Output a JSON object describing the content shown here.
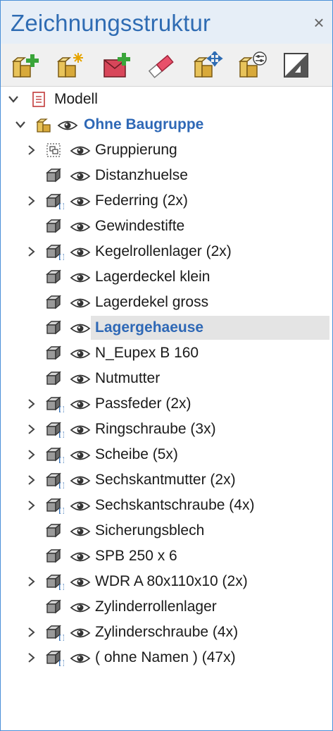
{
  "panel": {
    "title": "Zeichnungsstruktur",
    "close_symbol": "×"
  },
  "toolbar": {
    "buttons": [
      {
        "name": "new-assembly-button",
        "icon": "assembly-add-icon"
      },
      {
        "name": "new-empty-assembly-button",
        "icon": "assembly-star-icon"
      },
      {
        "name": "new-group-button",
        "icon": "group-add-icon"
      },
      {
        "name": "delete-button",
        "icon": "eraser-icon"
      },
      {
        "name": "move-button",
        "icon": "assembly-move-icon"
      },
      {
        "name": "properties-button",
        "icon": "assembly-settings-icon"
      },
      {
        "name": "visibility-toggle-button",
        "icon": "contrast-icon"
      }
    ]
  },
  "tree": {
    "root": {
      "label": "Modell",
      "icon": "document-icon",
      "expanded": true
    },
    "assembly": {
      "label": "Ohne Baugruppe",
      "icon": "assembly-icon",
      "expanded": true
    },
    "items": [
      {
        "label": "Gruppierung",
        "expandable": true,
        "kind": "group"
      },
      {
        "label": "Distanzhuelse",
        "expandable": false,
        "kind": "part"
      },
      {
        "label": "Federring (2x)",
        "expandable": true,
        "kind": "multi"
      },
      {
        "label": "Gewindestifte",
        "expandable": false,
        "kind": "part"
      },
      {
        "label": "Kegelrollenlager (2x)",
        "expandable": true,
        "kind": "multi"
      },
      {
        "label": "Lagerdeckel klein",
        "expandable": false,
        "kind": "part"
      },
      {
        "label": "Lagerdekel gross",
        "expandable": false,
        "kind": "part"
      },
      {
        "label": "Lagergehaeuse",
        "expandable": false,
        "kind": "part",
        "selected": true
      },
      {
        "label": "N_Eupex B 160",
        "expandable": false,
        "kind": "part"
      },
      {
        "label": "Nutmutter",
        "expandable": false,
        "kind": "part"
      },
      {
        "label": "Passfeder (2x)",
        "expandable": true,
        "kind": "multi"
      },
      {
        "label": "Ringschraube (3x)",
        "expandable": true,
        "kind": "multi"
      },
      {
        "label": "Scheibe (5x)",
        "expandable": true,
        "kind": "multi"
      },
      {
        "label": "Sechskantmutter (2x)",
        "expandable": true,
        "kind": "multi"
      },
      {
        "label": "Sechskantschraube (4x)",
        "expandable": true,
        "kind": "multi"
      },
      {
        "label": "Sicherungsblech",
        "expandable": false,
        "kind": "part"
      },
      {
        "label": "SPB 250 x 6",
        "expandable": false,
        "kind": "part"
      },
      {
        "label": "WDR A 80x110x10 (2x)",
        "expandable": true,
        "kind": "multi"
      },
      {
        "label": "Zylinderrollenlager",
        "expandable": false,
        "kind": "part"
      },
      {
        "label": "Zylinderschraube (4x)",
        "expandable": true,
        "kind": "multi"
      },
      {
        "label": "( ohne Namen ) (47x)",
        "expandable": true,
        "kind": "multi"
      }
    ]
  },
  "colors": {
    "title": "#2f6cb3",
    "accent_text": "#2e68b6",
    "selection": "#e4e4e4",
    "border": "#4a8fd8"
  }
}
